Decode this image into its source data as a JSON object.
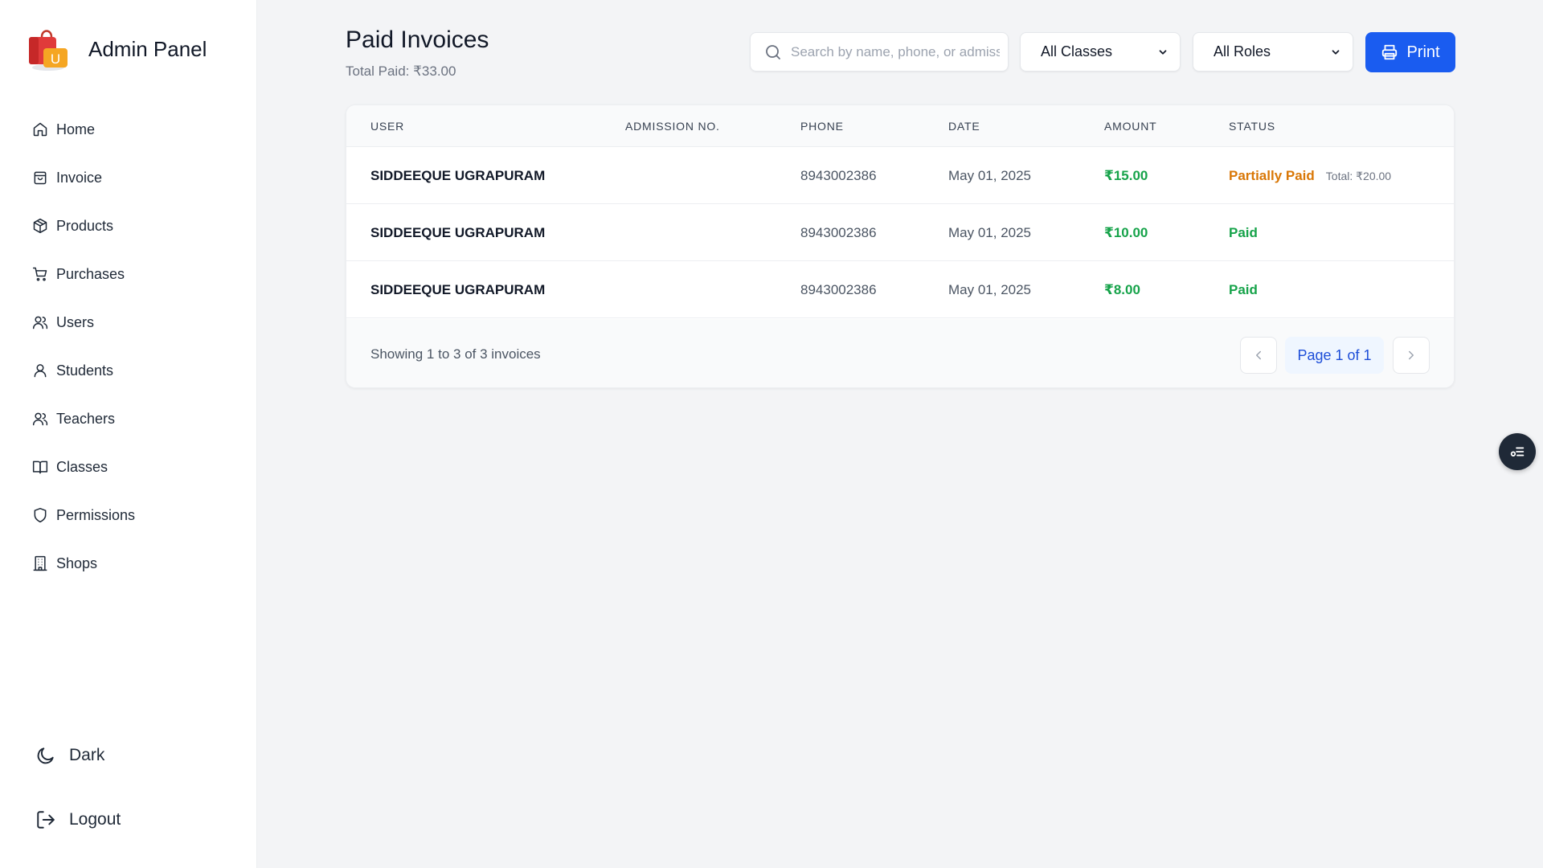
{
  "sidebar": {
    "brand": {
      "title": "Admin Panel",
      "logo_icon": "shopping-bag-icon",
      "logo_letter": "U"
    },
    "items": [
      {
        "label": "Home",
        "icon": "home-icon"
      },
      {
        "label": "Invoice",
        "icon": "invoice-icon"
      },
      {
        "label": "Products",
        "icon": "package-icon"
      },
      {
        "label": "Purchases",
        "icon": "cart-icon"
      },
      {
        "label": "Users",
        "icon": "users-icon"
      },
      {
        "label": "Students",
        "icon": "user-icon"
      },
      {
        "label": "Teachers",
        "icon": "users-icon"
      },
      {
        "label": "Classes",
        "icon": "book-icon"
      },
      {
        "label": "Permissions",
        "icon": "shield-icon"
      },
      {
        "label": "Shops",
        "icon": "building-icon"
      }
    ],
    "theme_toggle": {
      "label": "Dark",
      "icon": "moon-icon"
    },
    "logout": {
      "label": "Logout",
      "icon": "logout-icon"
    }
  },
  "header": {
    "title": "Paid Invoices",
    "subtitle": "Total Paid: ₹33.00",
    "search": {
      "placeholder": "Search by name, phone, or admission no.",
      "value": ""
    },
    "class_filter": {
      "selected": "All Classes"
    },
    "role_filter": {
      "selected": "All Roles"
    },
    "print_label": "Print"
  },
  "table": {
    "columns": [
      "USER",
      "ADMISSION NO.",
      "PHONE",
      "DATE",
      "AMOUNT",
      "STATUS"
    ],
    "rows": [
      {
        "user": "SIDDEEQUE UGRAPURAM",
        "admission_no": "",
        "phone": "8943002386",
        "date": "May 01, 2025",
        "amount": "₹15.00",
        "status": "Partially Paid",
        "total": "Total: ₹20.00"
      },
      {
        "user": "SIDDEEQUE UGRAPURAM",
        "admission_no": "",
        "phone": "8943002386",
        "date": "May 01, 2025",
        "amount": "₹10.00",
        "status": "Paid",
        "total": ""
      },
      {
        "user": "SIDDEEQUE UGRAPURAM",
        "admission_no": "",
        "phone": "8943002386",
        "date": "May 01, 2025",
        "amount": "₹8.00",
        "status": "Paid",
        "total": ""
      }
    ],
    "footer": {
      "showing": "Showing 1 to 3 of 3 invoices",
      "page_label": "Page 1 of 1"
    }
  },
  "colors": {
    "accent": "#1a5cf0",
    "paid": "#16a34a",
    "partial": "#d97706"
  }
}
